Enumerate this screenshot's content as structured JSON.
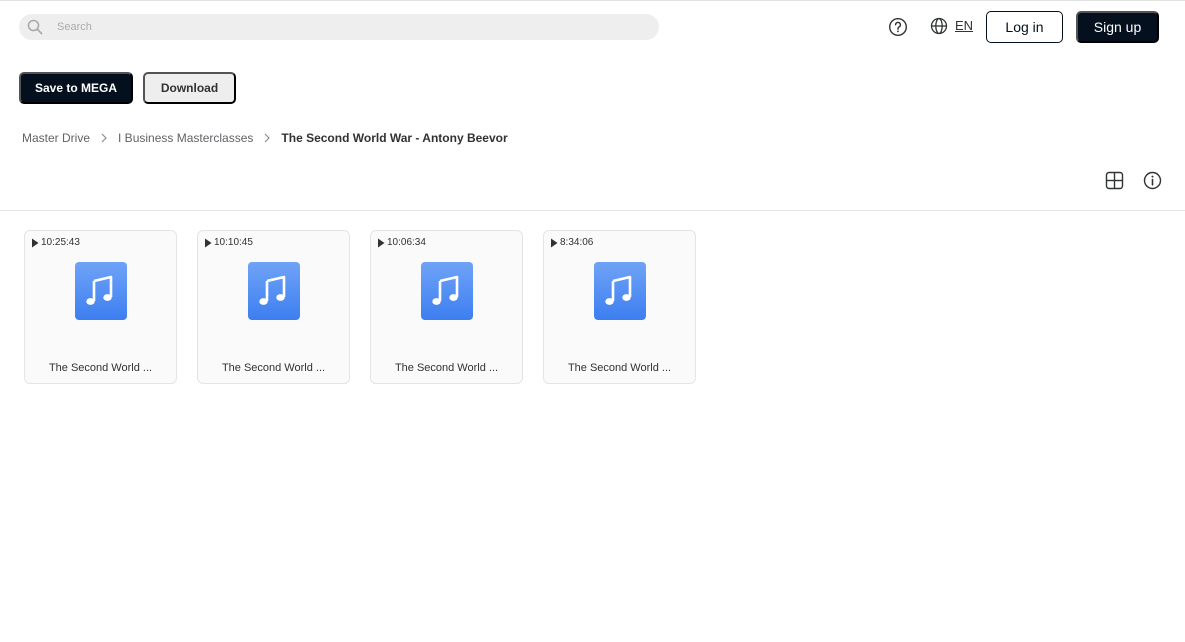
{
  "header": {
    "search_placeholder": "Search",
    "language": "EN",
    "login_label": "Log in",
    "signup_label": "Sign up",
    "icons": [
      "search-icon",
      "help-icon",
      "globe-icon"
    ]
  },
  "actions": {
    "save_label": "Save to MEGA",
    "download_label": "Download"
  },
  "breadcrumb": {
    "items": [
      "Master Drive",
      "I Business Masterclasses"
    ],
    "current": "The Second World War - Antony Beevor"
  },
  "view_controls": [
    "grid-view-icon",
    "info-icon"
  ],
  "files": [
    {
      "duration": "10:25:43",
      "name": "The Second World ..."
    },
    {
      "duration": "10:10:45",
      "name": "The Second World ..."
    },
    {
      "duration": "10:06:34",
      "name": "The Second World ..."
    },
    {
      "duration": "8:34:06",
      "name": "The Second World ..."
    }
  ],
  "colors": {
    "primary_dark": "#04101e",
    "light_button": "#eeeeee",
    "music_icon_top": "#6fa3f7",
    "music_icon_bottom": "#3d7ef0"
  }
}
